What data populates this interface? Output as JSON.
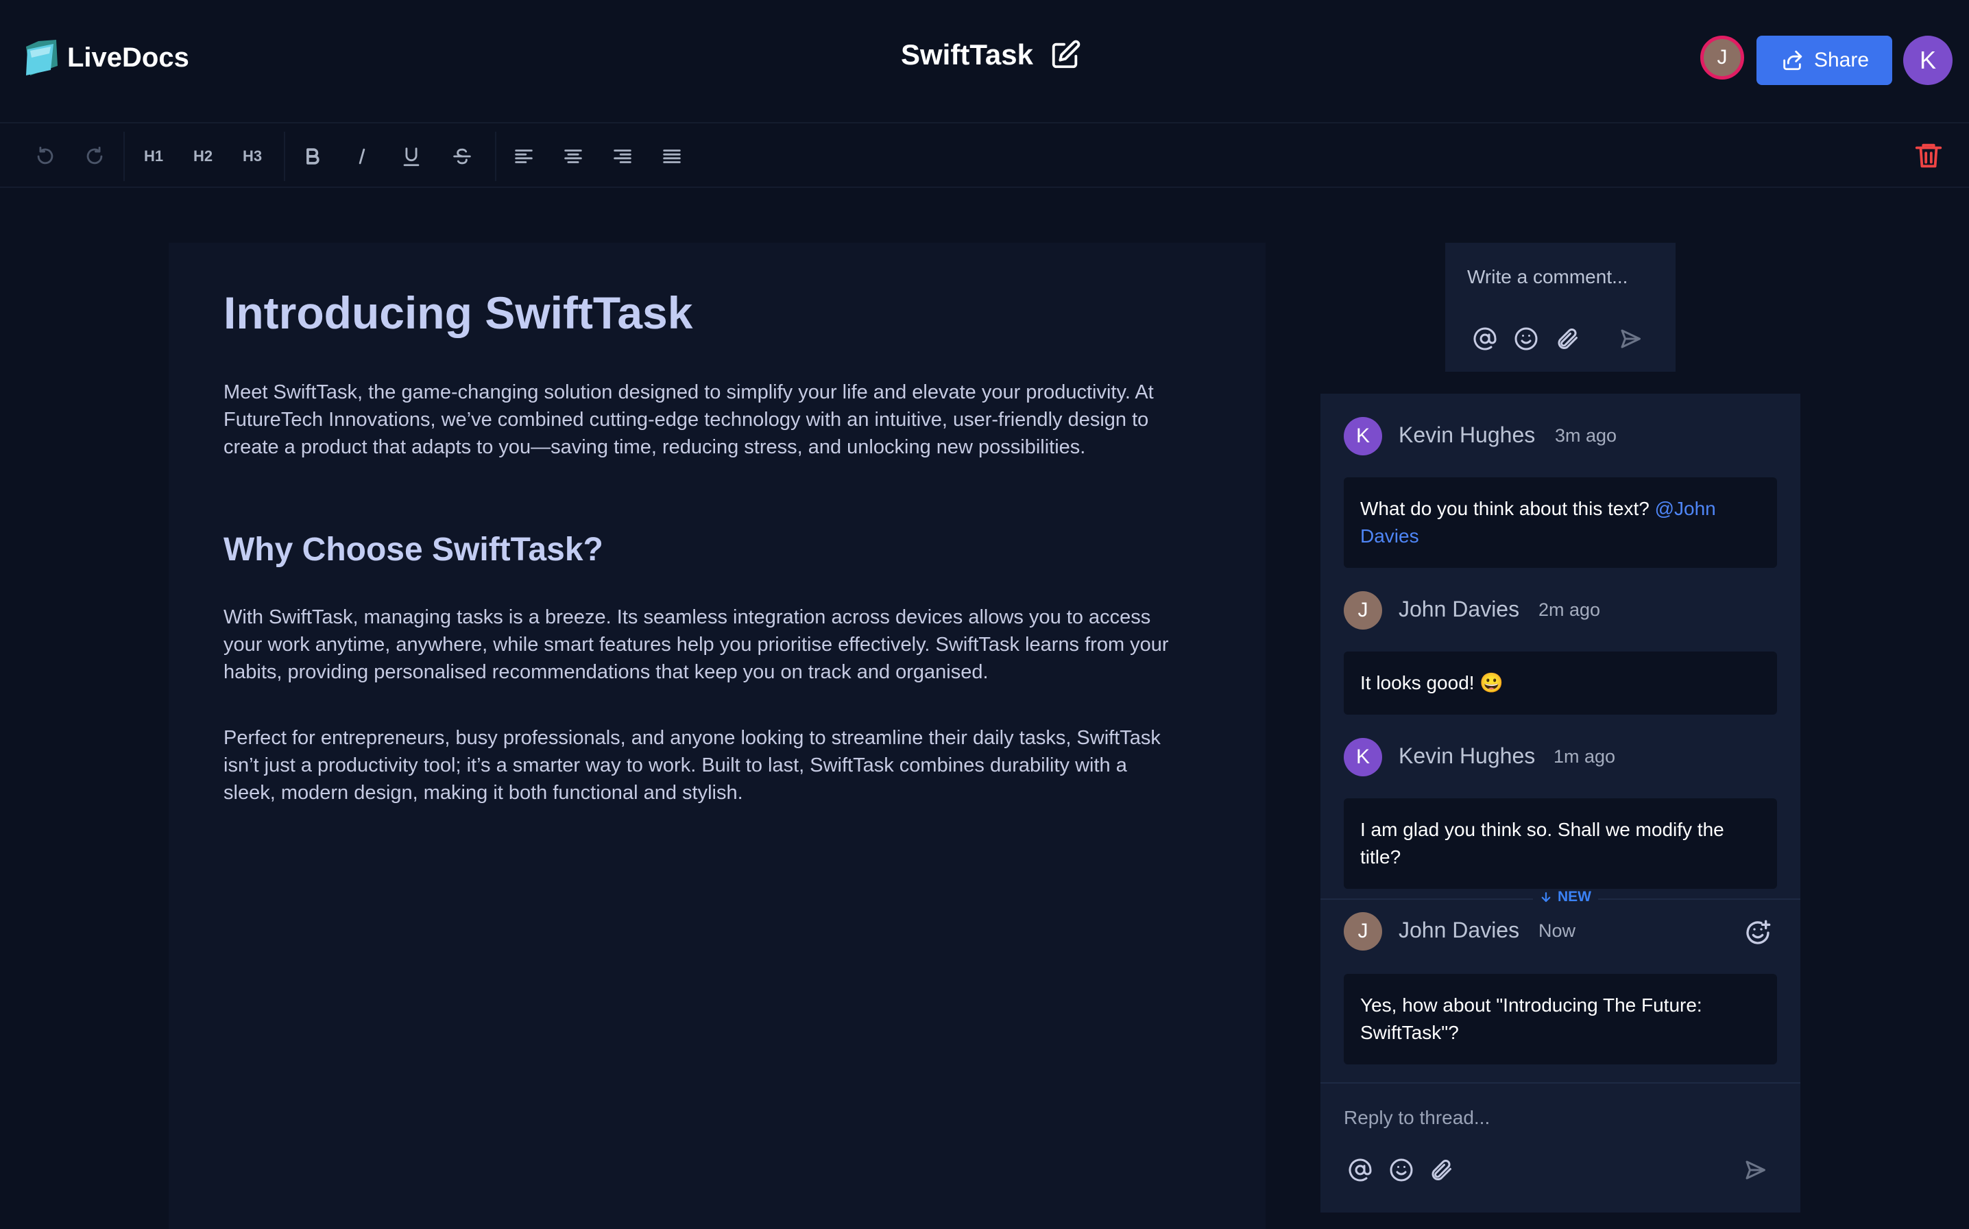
{
  "app": {
    "name": "LiveDocs"
  },
  "document": {
    "title": "SwiftTask"
  },
  "header": {
    "collaborator_initial": "J",
    "share_label": "Share",
    "user_initial": "K"
  },
  "toolbar": {
    "h1": "H1",
    "h2": "H2",
    "h3": "H3"
  },
  "content": {
    "heading": "Introducing SwiftTask",
    "intro": "Meet SwiftTask, the game-changing solution designed to simplify your life and elevate your productivity. At FutureTech Innovations, we’ve combined cutting-edge technology with an intuitive, user-friendly design to create a product that adapts to you—saving time, reducing stress, and unlocking new possibilities.",
    "subheading": "Why Choose SwiftTask?",
    "para1": "With SwiftTask, managing tasks is a breeze. Its seamless integration across devices allows you to access your work anytime, anywhere, while smart features help you prioritise effectively. SwiftTask learns from your habits, providing personalised recommendations that keep you on track and organised.",
    "para2": "Perfect for entrepreneurs, busy professionals, and anyone looking to streamline their daily tasks, SwiftTask isn’t just a productivity tool; it’s a smarter way to work. Built to last, SwiftTask combines durability with a sleek, modern design, making it both functional and stylish."
  },
  "comment_box": {
    "placeholder": "Write a comment..."
  },
  "thread": {
    "comments": [
      {
        "initial": "K",
        "author": "Kevin Hughes",
        "time": "3m ago",
        "text": "What do you think about this text? ",
        "mention": "@John Davies"
      },
      {
        "initial": "J",
        "author": "John Davies",
        "time": "2m ago",
        "text": "It looks good! 😀"
      },
      {
        "initial": "K",
        "author": "Kevin Hughes",
        "time": "1m ago",
        "text": "I am glad you think so. Shall we modify the title?"
      },
      {
        "initial": "J",
        "author": "John Davies",
        "time": "Now",
        "text": "Yes, how about \"Introducing The Future: SwiftTask\"?"
      }
    ],
    "new_label": "NEW",
    "reply_placeholder": "Reply to thread..."
  },
  "colors": {
    "background": "#0b1120",
    "accent": "#3b73ee",
    "mention": "#4f86f7",
    "danger": "#ef4444"
  }
}
